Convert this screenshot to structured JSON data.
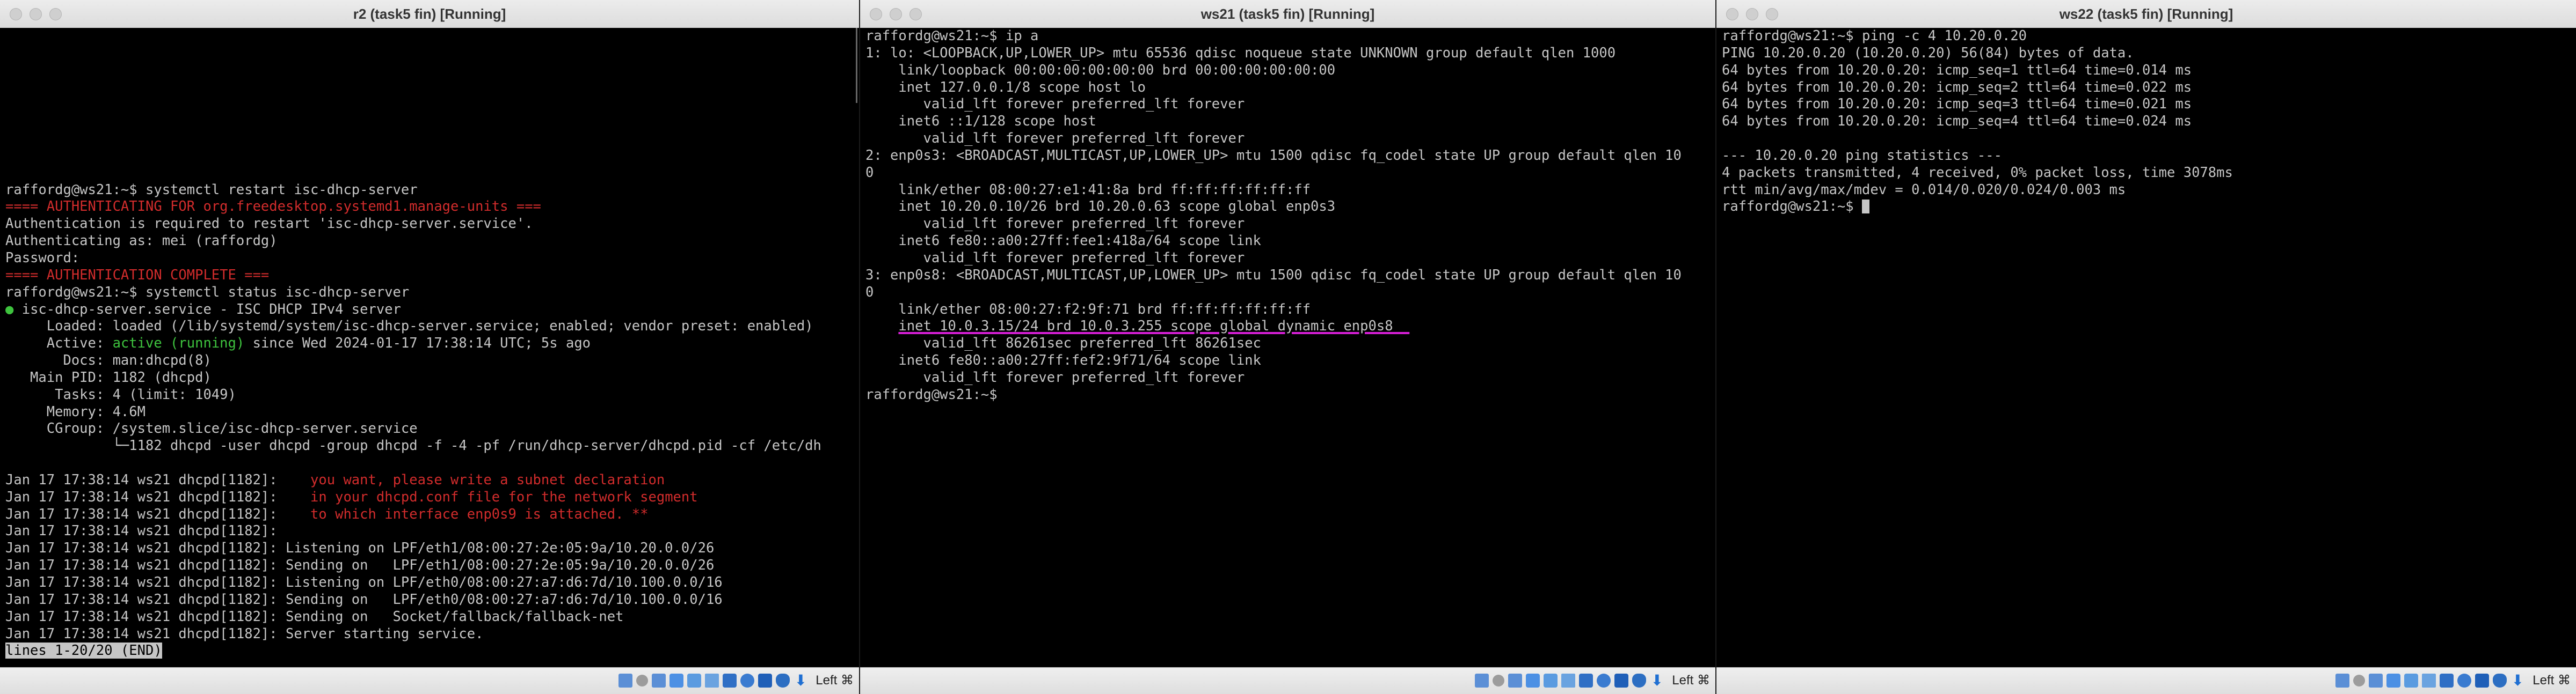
{
  "windows": [
    {
      "title": "r2 (task5 fin) [Running]",
      "lines": [
        {
          "segments": [
            {
              "text": ""
            }
          ]
        },
        {
          "segments": [
            {
              "text": ""
            }
          ]
        },
        {
          "segments": [
            {
              "text": ""
            }
          ]
        },
        {
          "segments": [
            {
              "text": ""
            }
          ]
        },
        {
          "segments": [
            {
              "text": ""
            }
          ]
        },
        {
          "segments": [
            {
              "text": ""
            }
          ]
        },
        {
          "segments": [
            {
              "text": ""
            }
          ]
        },
        {
          "segments": [
            {
              "text": ""
            }
          ]
        },
        {
          "segments": [
            {
              "text": ""
            }
          ]
        },
        {
          "segments": [
            {
              "text": "raffordg@ws21:~$ systemctl restart isc-dhcp-server"
            }
          ]
        },
        {
          "segments": [
            {
              "text": "==== AUTHENTICATING FOR org.freedesktop.systemd1.manage-units ===",
              "color": "red"
            }
          ]
        },
        {
          "segments": [
            {
              "text": "Authentication is required to restart 'isc-dhcp-server.service'."
            }
          ]
        },
        {
          "segments": [
            {
              "text": "Authenticating as: mei (raffordg)"
            }
          ]
        },
        {
          "segments": [
            {
              "text": "Password:"
            }
          ]
        },
        {
          "segments": [
            {
              "text": "==== AUTHENTICATION COMPLETE ===",
              "color": "red"
            }
          ]
        },
        {
          "segments": [
            {
              "text": "raffordg@ws21:~$ systemctl status isc-dhcp-server"
            }
          ]
        },
        {
          "segments": [
            {
              "text": "●",
              "color": "green"
            },
            {
              "text": " isc-dhcp-server.service - ISC DHCP IPv4 server"
            }
          ]
        },
        {
          "segments": [
            {
              "text": "     Loaded: loaded (/lib/systemd/system/isc-dhcp-server.service; enabled; vendor preset: enabled)"
            }
          ]
        },
        {
          "segments": [
            {
              "text": "     Active: "
            },
            {
              "text": "active (running)",
              "color": "green"
            },
            {
              "text": " since Wed 2024-01-17 17:38:14 UTC; 5s ago"
            }
          ]
        },
        {
          "segments": [
            {
              "text": "       Docs: man:dhcpd(8)"
            }
          ]
        },
        {
          "segments": [
            {
              "text": "   Main PID: 1182 (dhcpd)"
            }
          ]
        },
        {
          "segments": [
            {
              "text": "      Tasks: 4 (limit: 1049)"
            }
          ]
        },
        {
          "segments": [
            {
              "text": "     Memory: 4.6M"
            }
          ]
        },
        {
          "segments": [
            {
              "text": "     CGroup: /system.slice/isc-dhcp-server.service"
            }
          ]
        },
        {
          "segments": [
            {
              "text": "             └─1182 dhcpd -user dhcpd -group dhcpd -f -4 -pf /run/dhcp-server/dhcpd.pid -cf /etc/dh"
            }
          ]
        },
        {
          "segments": [
            {
              "text": ""
            }
          ]
        },
        {
          "segments": [
            {
              "text": "Jan 17 17:38:14 ws21 dhcpd[1182]:    "
            },
            {
              "text": "you want, please write a subnet declaration",
              "color": "red"
            }
          ]
        },
        {
          "segments": [
            {
              "text": "Jan 17 17:38:14 ws21 dhcpd[1182]:    "
            },
            {
              "text": "in your dhcpd.conf file for the network segment",
              "color": "red"
            }
          ]
        },
        {
          "segments": [
            {
              "text": "Jan 17 17:38:14 ws21 dhcpd[1182]:    "
            },
            {
              "text": "to which interface enp0s9 is attached. **",
              "color": "red"
            }
          ]
        },
        {
          "segments": [
            {
              "text": "Jan 17 17:38:14 ws21 dhcpd[1182]:"
            }
          ]
        },
        {
          "segments": [
            {
              "text": "Jan 17 17:38:14 ws21 dhcpd[1182]: Listening on LPF/eth1/08:00:27:2e:05:9a/10.20.0.0/26"
            }
          ]
        },
        {
          "segments": [
            {
              "text": "Jan 17 17:38:14 ws21 dhcpd[1182]: Sending on   LPF/eth1/08:00:27:2e:05:9a/10.20.0.0/26"
            }
          ]
        },
        {
          "segments": [
            {
              "text": "Jan 17 17:38:14 ws21 dhcpd[1182]: Listening on LPF/eth0/08:00:27:a7:d6:7d/10.100.0.0/16"
            }
          ]
        },
        {
          "segments": [
            {
              "text": "Jan 17 17:38:14 ws21 dhcpd[1182]: Sending on   LPF/eth0/08:00:27:a7:d6:7d/10.100.0.0/16"
            }
          ]
        },
        {
          "segments": [
            {
              "text": "Jan 17 17:38:14 ws21 dhcpd[1182]: Sending on   Socket/fallback/fallback-net"
            }
          ]
        },
        {
          "segments": [
            {
              "text": "Jan 17 17:38:14 ws21 dhcpd[1182]: Server starting service."
            }
          ]
        },
        {
          "segments": [
            {
              "text": "lines 1-20/20 (END)",
              "color": "inverse"
            }
          ]
        }
      ],
      "host_key": "Left ⌘"
    },
    {
      "title": "ws21 (task5 fin) [Running]",
      "lines": [
        {
          "segments": [
            {
              "text": "raffordg@ws21:~$ ip a"
            }
          ]
        },
        {
          "segments": [
            {
              "text": "1: lo: <LOOPBACK,UP,LOWER_UP> mtu 65536 qdisc noqueue state UNKNOWN group default qlen 1000"
            }
          ]
        },
        {
          "segments": [
            {
              "text": "    link/loopback 00:00:00:00:00:00 brd 00:00:00:00:00:00"
            }
          ]
        },
        {
          "segments": [
            {
              "text": "    inet 127.0.0.1/8 scope host lo"
            }
          ]
        },
        {
          "segments": [
            {
              "text": "       valid_lft forever preferred_lft forever"
            }
          ]
        },
        {
          "segments": [
            {
              "text": "    inet6 ::1/128 scope host"
            }
          ]
        },
        {
          "segments": [
            {
              "text": "       valid_lft forever preferred_lft forever"
            }
          ]
        },
        {
          "segments": [
            {
              "text": "2: enp0s3: <BROADCAST,MULTICAST,UP,LOWER_UP> mtu 1500 qdisc fq_codel state UP group default qlen 10"
            }
          ]
        },
        {
          "segments": [
            {
              "text": "0"
            }
          ]
        },
        {
          "segments": [
            {
              "text": "    link/ether 08:00:27:e1:41:8a brd ff:ff:ff:ff:ff:ff"
            }
          ]
        },
        {
          "segments": [
            {
              "text": "    inet 10.20.0.10/26 brd 10.20.0.63 scope global enp0s3"
            }
          ]
        },
        {
          "segments": [
            {
              "text": "       valid_lft forever preferred_lft forever"
            }
          ]
        },
        {
          "segments": [
            {
              "text": "    inet6 fe80::a00:27ff:fee1:418a/64 scope link"
            }
          ]
        },
        {
          "segments": [
            {
              "text": "       valid_lft forever preferred_lft forever"
            }
          ]
        },
        {
          "segments": [
            {
              "text": "3: enp0s8: <BROADCAST,MULTICAST,UP,LOWER_UP> mtu 1500 qdisc fq_codel state UP group default qlen 10"
            }
          ]
        },
        {
          "segments": [
            {
              "text": "0"
            }
          ]
        },
        {
          "segments": [
            {
              "text": "    link/ether 08:00:27:f2:9f:71 brd ff:ff:ff:ff:ff:ff"
            }
          ]
        },
        {
          "segments": [
            {
              "text": "    "
            },
            {
              "text": "inet 10.0.3.15/24 brd 10.0.3.255 scope global dynamic enp0s8  ",
              "color": "underline"
            }
          ]
        },
        {
          "segments": [
            {
              "text": "       valid_lft 86261sec preferred_lft 86261sec"
            }
          ]
        },
        {
          "segments": [
            {
              "text": "    inet6 fe80::a00:27ff:fef2:9f71/64 scope link"
            }
          ]
        },
        {
          "segments": [
            {
              "text": "       valid_lft forever preferred_lft forever"
            }
          ]
        },
        {
          "segments": [
            {
              "text": "raffordg@ws21:~$"
            }
          ]
        }
      ],
      "host_key": "Left ⌘"
    },
    {
      "title": "ws22 (task5 fin) [Running]",
      "lines": [
        {
          "segments": [
            {
              "text": "raffordg@ws21:~$ ping -c 4 10.20.0.20"
            }
          ]
        },
        {
          "segments": [
            {
              "text": "PING 10.20.0.20 (10.20.0.20) 56(84) bytes of data."
            }
          ]
        },
        {
          "segments": [
            {
              "text": "64 bytes from 10.20.0.20: icmp_seq=1 ttl=64 time=0.014 ms"
            }
          ]
        },
        {
          "segments": [
            {
              "text": "64 bytes from 10.20.0.20: icmp_seq=2 ttl=64 time=0.022 ms"
            }
          ]
        },
        {
          "segments": [
            {
              "text": "64 bytes from 10.20.0.20: icmp_seq=3 ttl=64 time=0.021 ms"
            }
          ]
        },
        {
          "segments": [
            {
              "text": "64 bytes from 10.20.0.20: icmp_seq=4 ttl=64 time=0.024 ms"
            }
          ]
        },
        {
          "segments": [
            {
              "text": ""
            }
          ]
        },
        {
          "segments": [
            {
              "text": "--- 10.20.0.20 ping statistics ---"
            }
          ]
        },
        {
          "segments": [
            {
              "text": "4 packets transmitted, 4 received, 0% packet loss, time 3078ms"
            }
          ]
        },
        {
          "segments": [
            {
              "text": "rtt min/avg/max/mdev = 0.014/0.020/0.024/0.003 ms"
            }
          ]
        },
        {
          "segments": [
            {
              "text": "raffordg@ws21:~$ "
            },
            {
              "text": "",
              "color": "cursor"
            }
          ]
        }
      ],
      "host_key": "Left ⌘"
    }
  ],
  "status_icons": [
    "hard-disk-icon",
    "optical-disc-icon",
    "audio-icon",
    "network-icon",
    "usb-icon",
    "shared-folder-icon",
    "display-icon",
    "video-capture-icon",
    "cpu-icon",
    "mouse-integration-icon",
    "keyboard-capture-arrow-icon"
  ],
  "colors": {
    "red": "#d22c2c",
    "green": "#3ec33e",
    "underline": "#d81fd8",
    "text": "#c6c6c6"
  }
}
